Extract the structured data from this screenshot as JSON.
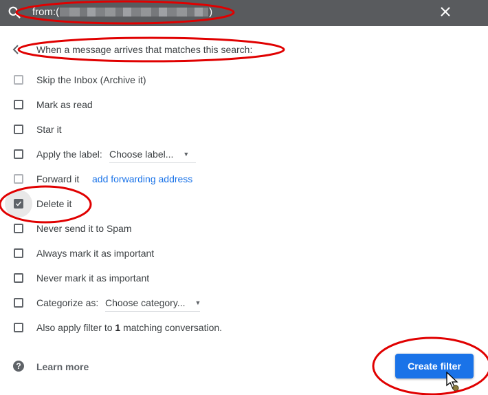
{
  "search_bar": {
    "query_prefix": "from:(",
    "query_suffix": ")",
    "icons": {
      "search": "search-icon",
      "close": "close-icon"
    }
  },
  "dialog": {
    "heading": "When a message arrives that matches this search:",
    "back_icon": "back-arrow-icon",
    "options": [
      {
        "label": "Skip the Inbox (Archive it)",
        "checked": false
      },
      {
        "label": "Mark as read",
        "checked": false
      },
      {
        "label": "Star it",
        "checked": false
      },
      {
        "label": "Apply the label:",
        "checked": false,
        "select_value": "Choose label..."
      },
      {
        "label": "Forward it",
        "checked": false,
        "link": "add forwarding address"
      },
      {
        "label": "Delete it",
        "checked": true
      },
      {
        "label": "Never send it to Spam",
        "checked": false
      },
      {
        "label": "Always mark it as important",
        "checked": false
      },
      {
        "label": "Never mark it as important",
        "checked": false
      },
      {
        "label": "Categorize as:",
        "checked": false,
        "select_value": "Choose category..."
      },
      {
        "label_prefix": "Also apply filter to",
        "count": "1",
        "label_suffix": "matching conversation.",
        "checked": false
      }
    ]
  },
  "footer": {
    "learn_more": "Learn more",
    "create_button": "Create filter",
    "help_icon": "help-icon"
  },
  "colors": {
    "top_bar": "#595b5e",
    "primary_button": "#1a73e8",
    "link": "#1a73e8",
    "annotation": "#e00000"
  }
}
